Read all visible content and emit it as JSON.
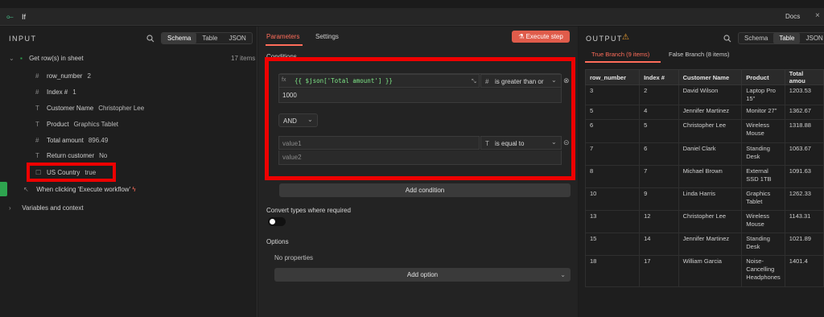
{
  "window": {
    "title": "If",
    "docs_label": "Docs"
  },
  "input": {
    "panel_title": "INPUT",
    "views": [
      "Schema",
      "Table",
      "JSON"
    ],
    "node_name": "Get row(s) in sheet",
    "item_count": "17 items",
    "fields": [
      {
        "type": "#",
        "name": "row_number",
        "value": "2"
      },
      {
        "type": "#",
        "name": "Index #",
        "value": "1"
      },
      {
        "type": "T",
        "name": "Customer Name",
        "value": "Christopher Lee"
      },
      {
        "type": "T",
        "name": "Product",
        "value": "Graphics Tablet"
      },
      {
        "type": "#",
        "name": "Total amount",
        "value": "896.49"
      },
      {
        "type": "T",
        "name": "Return customer",
        "value": "No"
      },
      {
        "type": "☐",
        "name": "US Country",
        "value": "true"
      }
    ],
    "trigger_label": "When clicking 'Execute workflow'",
    "variables_label": "Variables and context"
  },
  "params": {
    "tabs": [
      "Parameters",
      "Settings"
    ],
    "execute_label": "Execute step",
    "conditions_label": "Conditions",
    "cond1": {
      "fx": "fx",
      "left": "{{ $json['Total amount'] }}",
      "operator": "is greater than or",
      "right": "1000"
    },
    "combinator": "AND",
    "cond2": {
      "left_placeholder": "value1",
      "operator": "is equal to",
      "right_placeholder": "value2"
    },
    "add_condition": "Add condition",
    "convert_label": "Convert types where required",
    "options_label": "Options",
    "no_properties": "No properties",
    "add_option": "Add option"
  },
  "output": {
    "panel_title": "OUTPUT",
    "views": [
      "Schema",
      "Table",
      "JSON"
    ],
    "true_branch": "True Branch (9 items)",
    "false_branch": "False Branch (8 items)",
    "columns": [
      "row_number",
      "Index #",
      "Customer Name",
      "Product",
      "Total amou"
    ],
    "rows": [
      [
        "3",
        "2",
        "David Wilson",
        "Laptop Pro 15\"",
        "1203.53"
      ],
      [
        "5",
        "4",
        "Jennifer Martinez",
        "Monitor 27\"",
        "1362.67"
      ],
      [
        "6",
        "5",
        "Christopher Lee",
        "Wireless Mouse",
        "1318.88"
      ],
      [
        "7",
        "6",
        "Daniel Clark",
        "Standing Desk",
        "1063.67"
      ],
      [
        "8",
        "7",
        "Michael Brown",
        "External SSD 1TB",
        "1091.63"
      ],
      [
        "10",
        "9",
        "Linda Harris",
        "Graphics Tablet",
        "1262.33"
      ],
      [
        "13",
        "12",
        "Christopher Lee",
        "Wireless Mouse",
        "1143.31"
      ],
      [
        "15",
        "14",
        "Jennifer Martinez",
        "Standing Desk",
        "1021.89"
      ],
      [
        "18",
        "17",
        "William Garcia",
        "Noise-Cancelling Headphones",
        "1401.4"
      ]
    ]
  },
  "colors": {
    "accent": "#ff6d5a",
    "highlight": "#ee0000",
    "code": "#7ee787"
  }
}
